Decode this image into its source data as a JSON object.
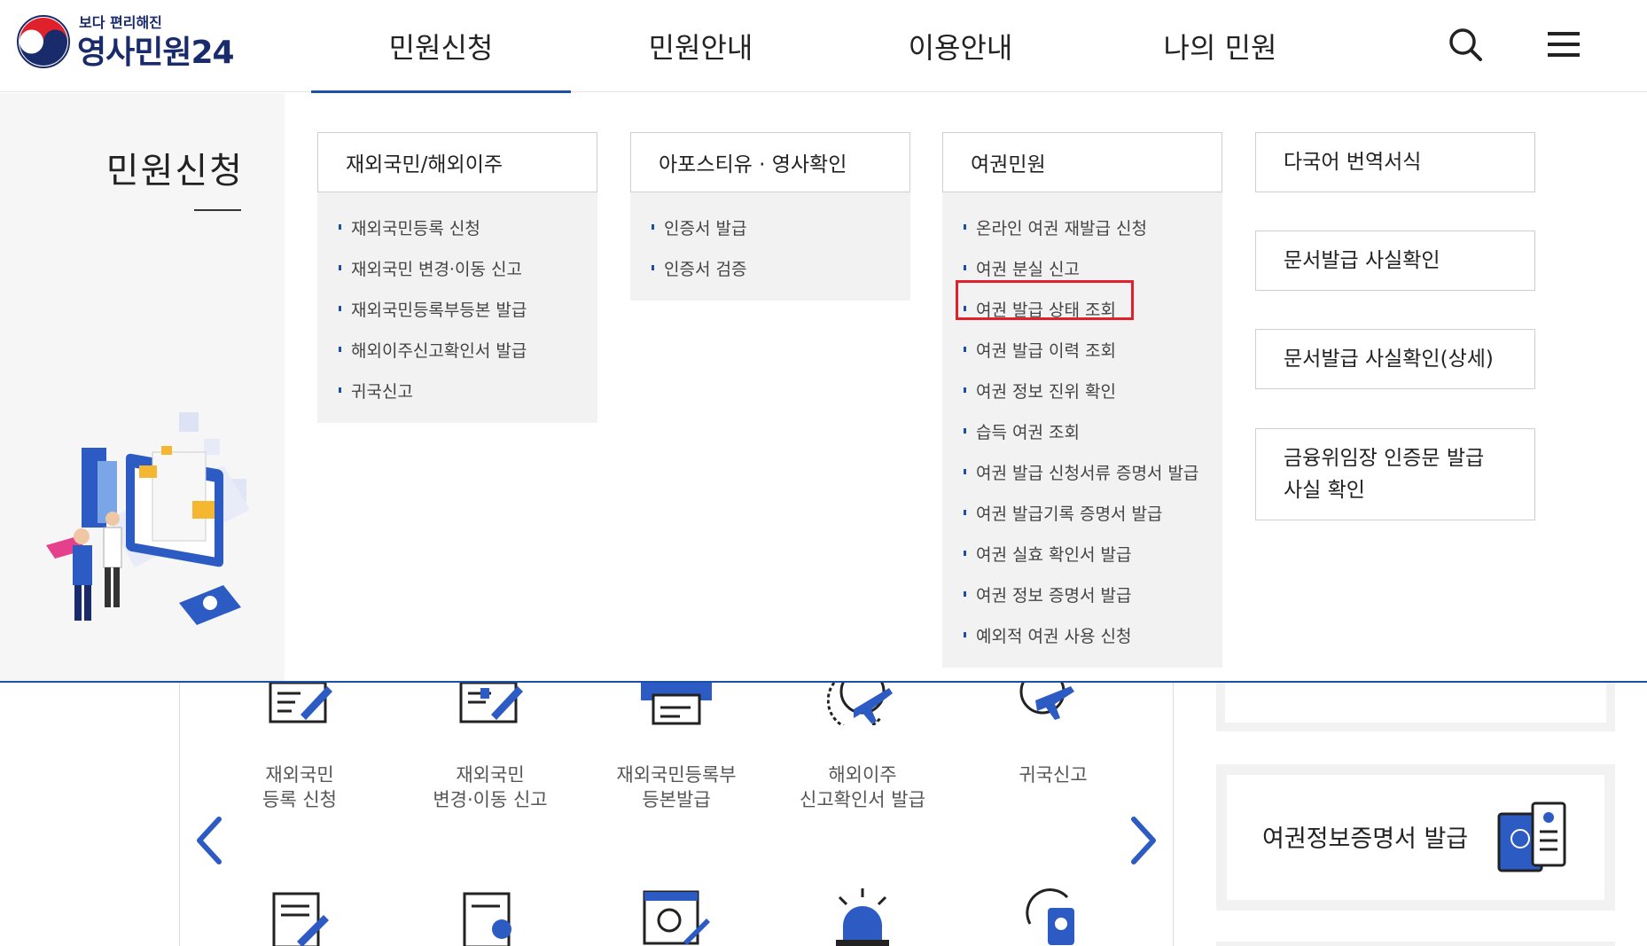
{
  "header": {
    "logo_tagline": "보다 편리해진",
    "logo_name": "영사민원24",
    "nav": [
      "민원신청",
      "민원안내",
      "이용안내",
      "나의 민원"
    ],
    "search_icon": "search-icon",
    "menu_icon": "hamburger-menu-icon"
  },
  "mega_menu": {
    "title": "민원신청",
    "columns": [
      {
        "heading": "재외국민/해외이주",
        "items": [
          "재외국민등록 신청",
          "재외국민 변경·이동 신고",
          "재외국민등록부등본 발급",
          "해외이주신고확인서 발급",
          "귀국신고"
        ]
      },
      {
        "heading": "아포스티유 · 영사확인",
        "items": [
          "인증서 발급",
          "인증서 검증"
        ]
      },
      {
        "heading": "여권민원",
        "items": [
          "온라인 여권 재발급 신청",
          "여권 분실 신고",
          "여권 발급 상태 조회",
          "여권 발급 이력 조회",
          "여권 정보 진위 확인",
          "습득 여권 조회",
          "여권 발급 신청서류 증명서 발급",
          "여권 발급기록 증명서 발급",
          "여권 실효 확인서 발급",
          "여권 정보 증명서 발급",
          "예외적 여권 사용 신청"
        ]
      }
    ],
    "box_links": [
      "다국어 번역서식",
      "문서발급 사실확인",
      "문서발급 사실확인(상세)",
      "금융위임장 인증문 발급 사실 확인"
    ],
    "box_link_4_line1": "금융위임장 인증문 발급",
    "box_link_4_line2": "사실 확인"
  },
  "quick_services": {
    "items": [
      {
        "line1": "재외국민",
        "line2": "등록 신청"
      },
      {
        "line1": "재외국민",
        "line2": "변경·이동 신고"
      },
      {
        "line1": "재외국민등록부",
        "line2": "등본발급"
      },
      {
        "line1": "해외이주",
        "line2": "신고확인서 발급"
      },
      {
        "line1": "귀국신고",
        "line2": ""
      }
    ],
    "prev_icon": "chevron-left-icon",
    "next_icon": "chevron-right-icon"
  },
  "side_card": {
    "label": "여권정보증명서 발급"
  },
  "colors": {
    "primary": "#1c4fa8",
    "navy": "#1a2b6b",
    "highlight": "#e0202a",
    "panel_bg": "#f2f2f2"
  }
}
